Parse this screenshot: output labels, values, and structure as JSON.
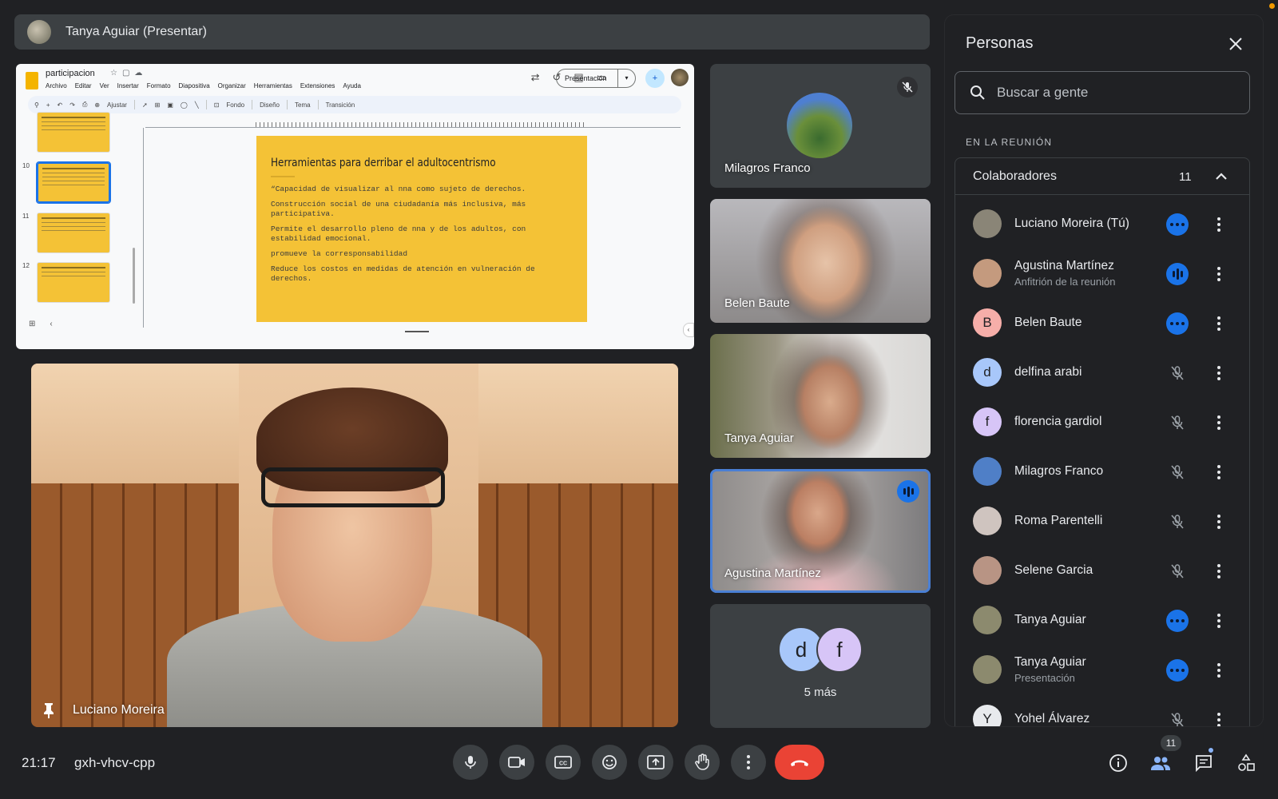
{
  "presenter_bar": {
    "name": "Tanya Aguiar (Presentar)"
  },
  "slides": {
    "doc_title": "participacion",
    "menu": [
      "Archivo",
      "Editar",
      "Ver",
      "Insertar",
      "Formato",
      "Diapositiva",
      "Organizar",
      "Herramientas",
      "Extensiones",
      "Ayuda"
    ],
    "present_button": "Presentación",
    "toolbar": {
      "zoom": "Ajustar",
      "fondo": "Fondo",
      "diseno": "Diseño",
      "tema": "Tema",
      "transicion": "Transición"
    },
    "thumb_numbers": [
      "10",
      "11",
      "12"
    ],
    "slide_title": "Herramientas para derribar el adultocentrismo",
    "slide_points": [
      "“Capacidad de visualizar al nna como sujeto de derechos.",
      "Construcción social de una ciudadanía más inclusiva, más participativa.",
      "Permite el desarrollo pleno de nna y de los adultos, con estabilidad emocional.",
      "promueve la corresponsabilidad",
      "Reduce los costos en medidas de atención en vulneración de derechos."
    ]
  },
  "main_tile": {
    "name": "Luciano Moreira"
  },
  "tiles": [
    {
      "name": "Milagros Franco",
      "muted": true
    },
    {
      "name": "Belen Baute"
    },
    {
      "name": "Tanya Aguiar"
    },
    {
      "name": "Agustina Martínez",
      "speaking": true
    }
  ],
  "more_tile": {
    "initials": [
      "d",
      "f"
    ],
    "label": "5 más"
  },
  "people_panel": {
    "title": "Personas",
    "search_placeholder": "Buscar a gente",
    "section": "EN LA REUNIÓN",
    "group_name": "Colaboradores",
    "group_count": "11",
    "people": [
      {
        "name": "Luciano Moreira (Tú)",
        "status": "dots",
        "initial": "",
        "color": "#8a8577"
      },
      {
        "name": "Agustina Martínez",
        "sub": "Anfitrión de la reunión",
        "status": "speaking",
        "initial": "",
        "color": "#c49a7e"
      },
      {
        "name": "Belen Baute",
        "status": "dots",
        "initial": "B",
        "color": "#f6aea9"
      },
      {
        "name": "delfina arabi",
        "status": "muted",
        "initial": "d",
        "color": "#a8c7fa"
      },
      {
        "name": "florencia gardiol",
        "status": "muted",
        "initial": "f",
        "color": "#d7c5f7"
      },
      {
        "name": "Milagros Franco",
        "status": "muted",
        "initial": "",
        "color": "#4f7fc7"
      },
      {
        "name": "Roma Parentelli",
        "status": "muted",
        "initial": "",
        "color": "#cfc4bf"
      },
      {
        "name": "Selene Garcia",
        "status": "muted",
        "initial": "",
        "color": "#b89484"
      },
      {
        "name": "Tanya Aguiar",
        "status": "dots",
        "initial": "",
        "color": "#8c8a6e"
      },
      {
        "name": "Tanya Aguiar",
        "sub": "Presentación",
        "status": "dots",
        "initial": "",
        "color": "#8c8a6e"
      },
      {
        "name": "Yohel Álvarez",
        "status": "muted",
        "initial": "Y",
        "color": "#e8eaed"
      }
    ]
  },
  "bottom_bar": {
    "time": "21:17",
    "meeting_code": "gxh-vhcv-cpp",
    "people_badge": "11"
  },
  "colors": {
    "accent": "#1a73e8",
    "end_call": "#ea4335",
    "slide_bg": "#f4c236",
    "background": "#202124"
  }
}
